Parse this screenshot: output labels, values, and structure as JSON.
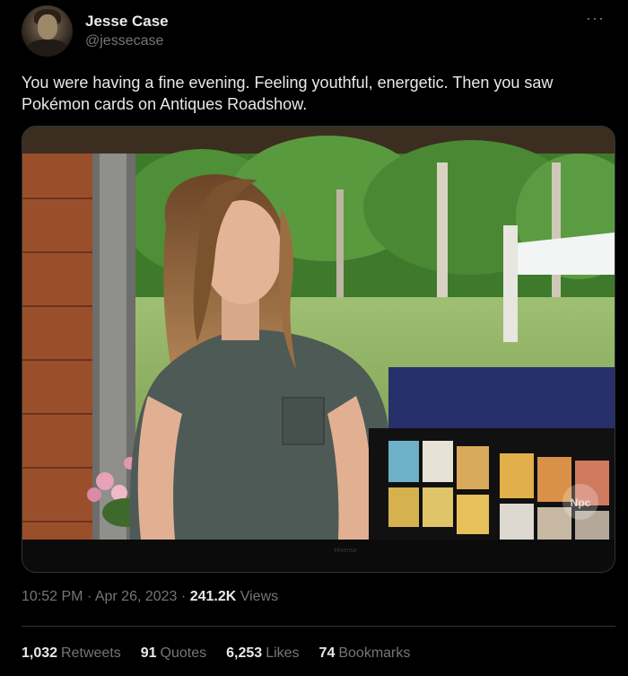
{
  "author": {
    "display_name": "Jesse Case",
    "handle": "@jessecase"
  },
  "more_icon": "more-horizontal-icon",
  "tweet": {
    "text": "You were having a fine evening. Feeling youthful, energetic. Then you saw Pokémon cards on Antiques Roadshow."
  },
  "media": {
    "description_icon": "tv-photo",
    "watermark": "Npc",
    "tv_brand": "Hisense"
  },
  "meta": {
    "time": "10:52 PM",
    "separator": "·",
    "date": "Apr 26, 2023",
    "views_count": "241.2K",
    "views_label": "Views"
  },
  "stats": {
    "retweets_count": "1,032",
    "retweets_label": "Retweets",
    "quotes_count": "91",
    "quotes_label": "Quotes",
    "likes_count": "6,253",
    "likes_label": "Likes",
    "bookmarks_count": "74",
    "bookmarks_label": "Bookmarks"
  },
  "colors": {
    "background": "#000000",
    "text": "#e7e9ea",
    "secondary": "#71767b",
    "divider": "#2f3336"
  }
}
